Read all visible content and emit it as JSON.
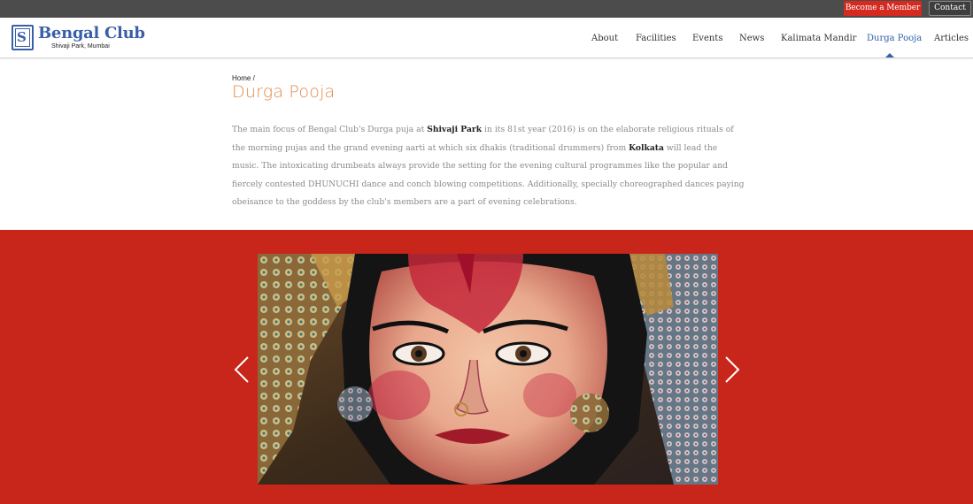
{
  "topbar": {
    "become_member": "Become a Member",
    "contact": "Contact"
  },
  "brand": {
    "name": "Bengal Club",
    "tagline": "Shivaji Park, Mumbai",
    "logo_letter": "S"
  },
  "nav": {
    "items": [
      {
        "label": "About"
      },
      {
        "label": "Facilities"
      },
      {
        "label": "Events"
      },
      {
        "label": "News"
      },
      {
        "label": "Kalimata Mandir"
      },
      {
        "label": "Durga Pooja"
      },
      {
        "label": "Articles"
      }
    ],
    "active": "Durga Pooja"
  },
  "breadcrumb": {
    "home": "Home",
    "separator": "/"
  },
  "page": {
    "title": "Durga Pooja",
    "intro": {
      "p1": "The main focus of Bengal Club's Durga puja at ",
      "b1": "Shivaji Park",
      "p2": " in its 81st year (2016) is on the elaborate religious rituals of the morning pujas and the grand evening aarti at which six dhakis (traditional drummers) from ",
      "b2": "Kolkata",
      "p3": " will lead the music. The intoxicating drumbeats always provide the setting for the evening cultural programmes like the popular and fiercely contested DHUNUCHI dance and conch blowing competitions. Additionally, specially choreographed dances paying obeisance to the goddess by the club's members are a part of evening celebrations."
    }
  },
  "slider": {
    "prev_icon": "chevron-left-icon",
    "next_icon": "chevron-right-icon"
  },
  "colors": {
    "accent_red": "#c8251b",
    "brand_blue": "#3a5fa8",
    "title_orange": "#e08a4a"
  }
}
